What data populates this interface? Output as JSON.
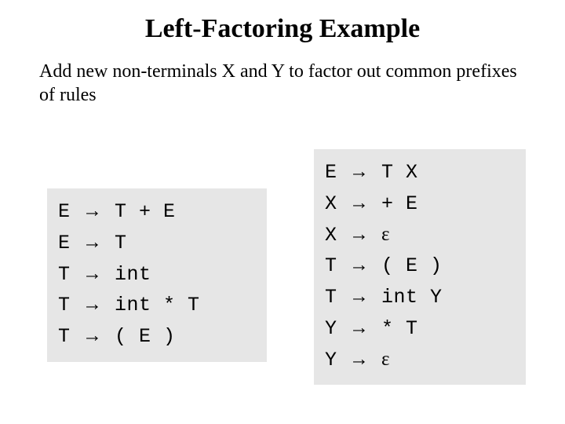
{
  "title": "Left-Factoring Example",
  "subtitle": "Add new non-terminals X and Y to factor out common prefixes of rules",
  "arrow": "→",
  "epsilon": "ε",
  "left_rules": [
    {
      "lhs": "E",
      "rhs": "T + E"
    },
    {
      "lhs": "E",
      "rhs": "T"
    },
    {
      "lhs": "T",
      "rhs": "int"
    },
    {
      "lhs": "T",
      "rhs": "int * T"
    },
    {
      "lhs": "T",
      "rhs": "( E )"
    }
  ],
  "right_rules": [
    {
      "lhs": "E",
      "rhs": "T X"
    },
    {
      "lhs": "X",
      "rhs": "+ E"
    },
    {
      "lhs": "X",
      "rhs": "ε"
    },
    {
      "lhs": "T",
      "rhs": "( E )"
    },
    {
      "lhs": "T",
      "rhs": "int Y"
    },
    {
      "lhs": "Y",
      "rhs": "* T"
    },
    {
      "lhs": "Y",
      "rhs": "ε"
    }
  ]
}
